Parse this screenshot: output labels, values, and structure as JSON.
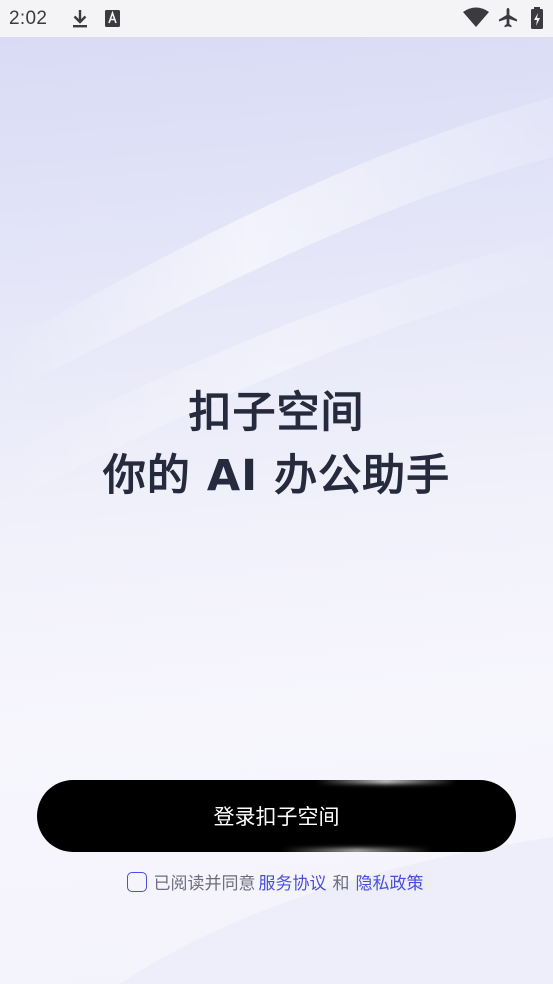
{
  "status_bar": {
    "time": "2:02",
    "icons": [
      "download-icon",
      "font-a-icon",
      "wifi-icon",
      "airplane-mode-icon",
      "battery-charging-icon"
    ]
  },
  "hero": {
    "line1": "扣子空间",
    "line2": "你的 AI 办公助手"
  },
  "login": {
    "button_label": "登录扣子空间"
  },
  "agreement": {
    "checked": false,
    "prefix": "已阅读并同意",
    "terms_link": "服务协议",
    "conjunction": "和",
    "privacy_link": "隐私政策"
  },
  "colors": {
    "accent": "#4a4fd8",
    "title_text": "#262a3d",
    "button_bg": "#000000"
  }
}
